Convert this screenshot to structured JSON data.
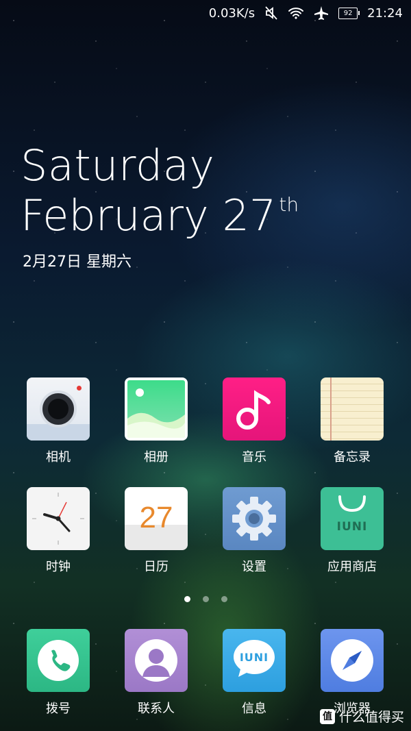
{
  "status": {
    "net_speed": "0.03K/s",
    "battery": "92",
    "time": "21:24"
  },
  "widget": {
    "day": "Saturday",
    "month_date": "February 27",
    "suffix": "th",
    "cn_date": "2月27日  星期六"
  },
  "apps": [
    {
      "label": "相机",
      "icon": "camera-icon"
    },
    {
      "label": "相册",
      "icon": "gallery-icon"
    },
    {
      "label": "音乐",
      "icon": "music-icon"
    },
    {
      "label": "备忘录",
      "icon": "notes-icon"
    },
    {
      "label": "时钟",
      "icon": "clock-icon"
    },
    {
      "label": "日历",
      "icon": "calendar-icon",
      "number": "27"
    },
    {
      "label": "设置",
      "icon": "gear-icon"
    },
    {
      "label": "应用商店",
      "icon": "app-store-icon",
      "brand": "IUNI"
    }
  ],
  "dock": [
    {
      "label": "拨号",
      "icon": "phone-icon"
    },
    {
      "label": "联系人",
      "icon": "contacts-icon"
    },
    {
      "label": "信息",
      "icon": "messages-icon",
      "brand": "IUNI"
    },
    {
      "label": "浏览器",
      "icon": "compass-icon"
    }
  ],
  "pages": {
    "count": 3,
    "active": 1
  },
  "watermark": {
    "logo": "值",
    "text": "什么值得买"
  }
}
